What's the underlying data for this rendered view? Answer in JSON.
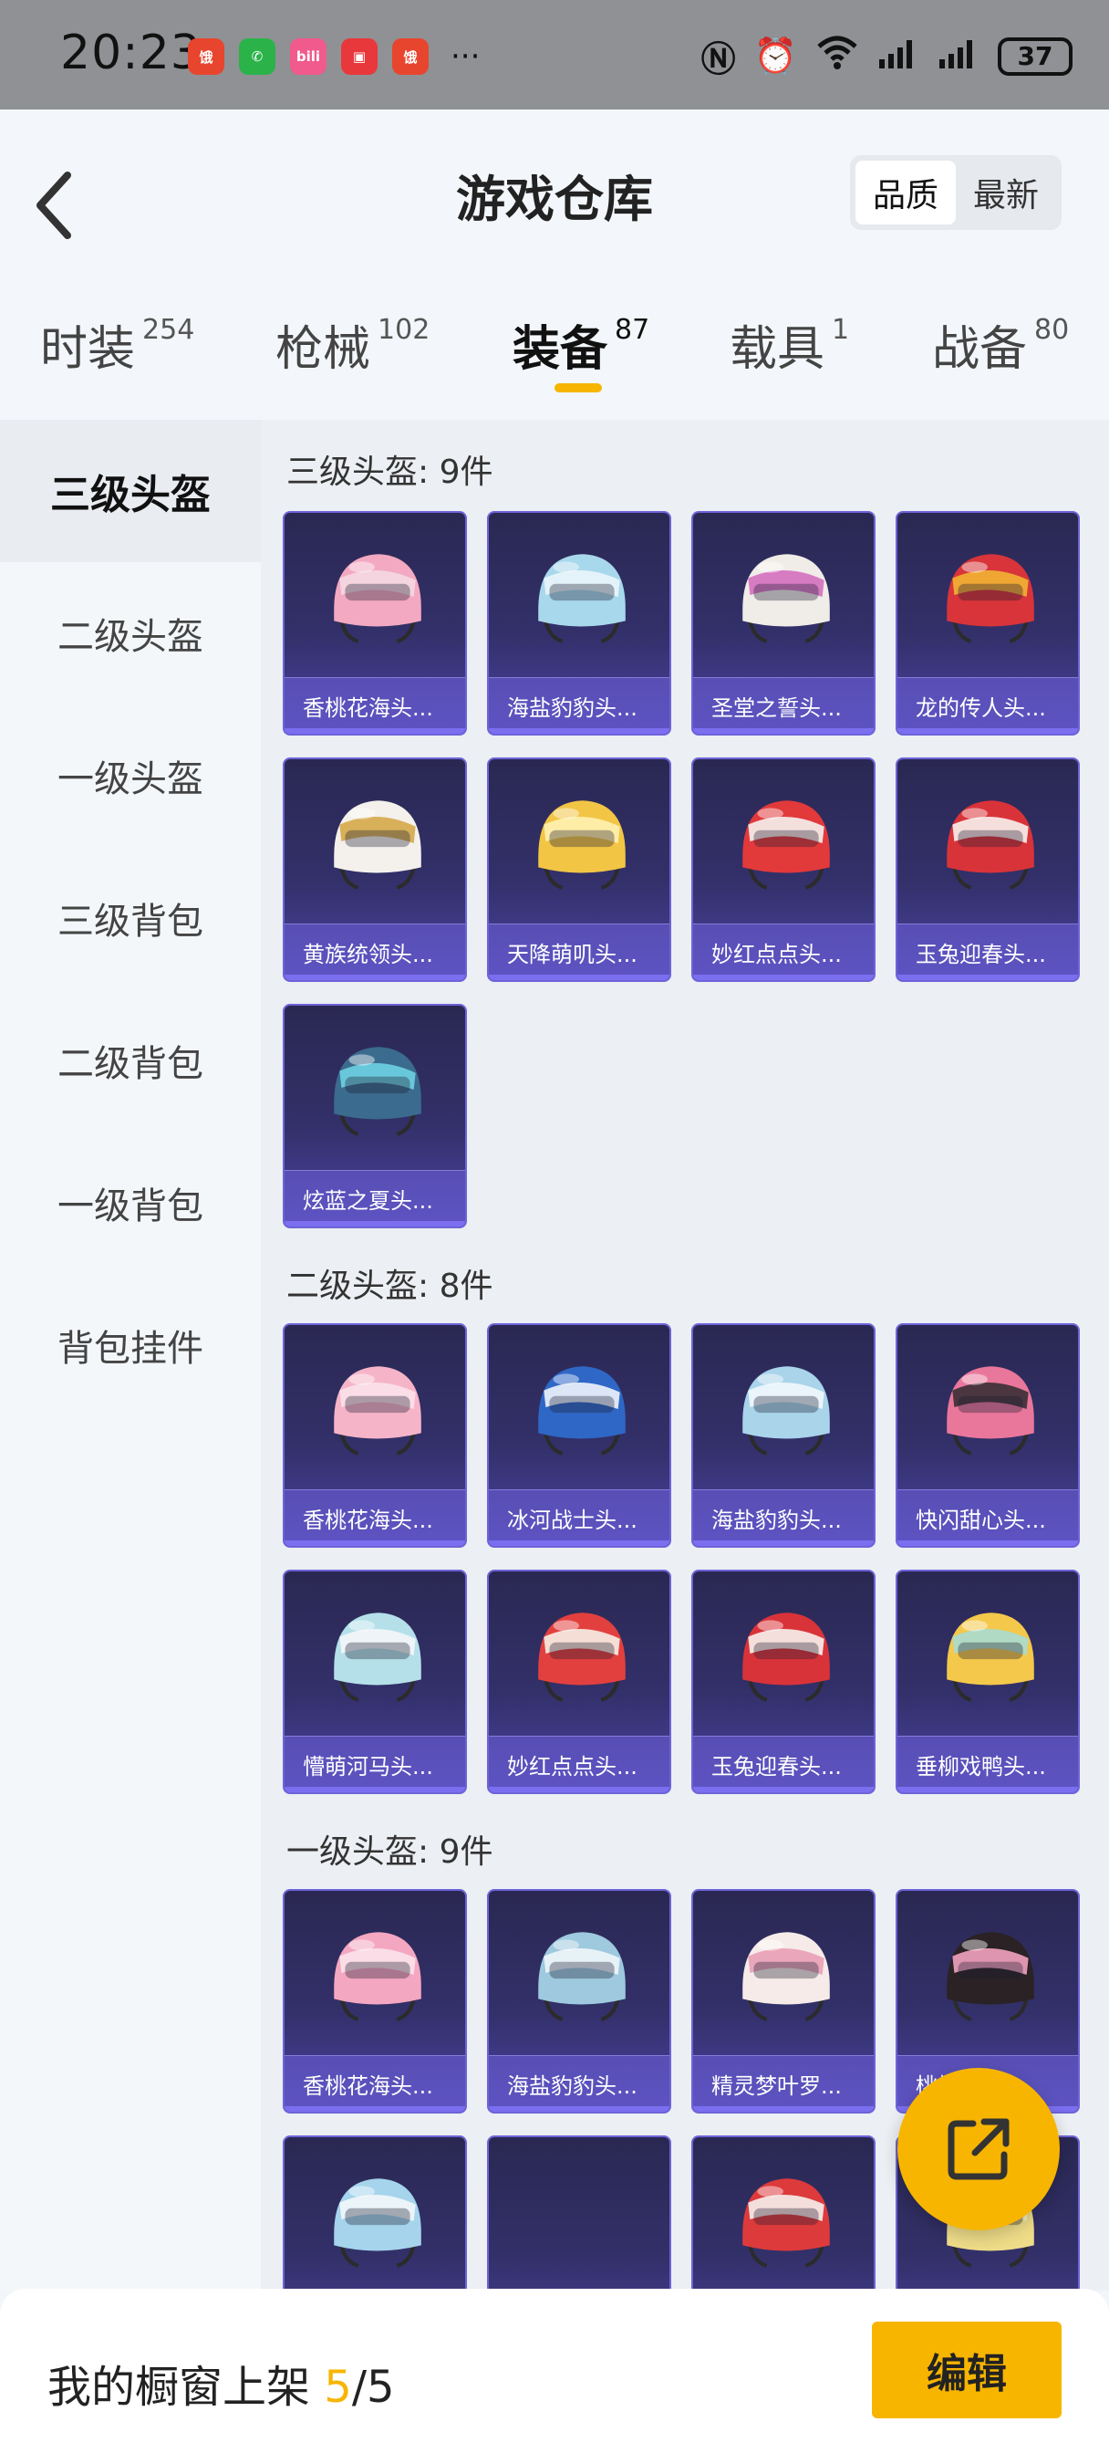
{
  "status_bar": {
    "time": "20:23",
    "apps": [
      {
        "name": "food-app-icon",
        "color": "#e8452e",
        "glyph": "饿"
      },
      {
        "name": "wechat-icon",
        "color": "#2bb34a",
        "glyph": "✆"
      },
      {
        "name": "bilibili-icon",
        "color": "#f05a8c",
        "glyph": "bili"
      },
      {
        "name": "red-app-icon",
        "color": "#e8383b",
        "glyph": "▣"
      },
      {
        "name": "food-app-icon-2",
        "color": "#e8452e",
        "glyph": "饿"
      }
    ],
    "more": "···",
    "battery": "37"
  },
  "header": {
    "title": "游戏仓库",
    "sort": [
      {
        "label": "品质",
        "active": true
      },
      {
        "label": "最新",
        "active": false
      }
    ]
  },
  "tabs": [
    {
      "label": "时装",
      "count": "254",
      "active": false
    },
    {
      "label": "枪械",
      "count": "102",
      "active": false
    },
    {
      "label": "装备",
      "count": "87",
      "active": true
    },
    {
      "label": "载具",
      "count": "1",
      "active": false
    },
    {
      "label": "战备",
      "count": "80",
      "active": false
    }
  ],
  "sidebar": {
    "items": [
      "三级头盔",
      "二级头盔",
      "一级头盔",
      "三级背包",
      "二级背包",
      "一级背包",
      "背包挂件"
    ],
    "active_index": 0
  },
  "sections": [
    {
      "title": "三级头盔: 9件",
      "items": [
        {
          "name": "香桃花海头...",
          "color": "#f3a9c1",
          "accent": "#f4d8e2"
        },
        {
          "name": "海盐豹豹头...",
          "color": "#a8d8ec",
          "accent": "#eaf6fb"
        },
        {
          "name": "圣堂之誓头...",
          "color": "#f0ece8",
          "accent": "#d46fbf"
        },
        {
          "name": "龙的传人头...",
          "color": "#d8343a",
          "accent": "#f2b233"
        },
        {
          "name": "黄族统领头...",
          "color": "#f4f1ec",
          "accent": "#d6a84a"
        },
        {
          "name": "天降萌叽头...",
          "color": "#f2c545",
          "accent": "#fff1b0"
        },
        {
          "name": "妙红点点头...",
          "color": "#e2393b",
          "accent": "#f5f3f0"
        },
        {
          "name": "玉兔迎春头...",
          "color": "#d9333a",
          "accent": "#f7f2ee"
        },
        {
          "name": "炫蓝之夏头...",
          "color": "#3b6b8e",
          "accent": "#6fd1e3"
        }
      ]
    },
    {
      "title": "二级头盔: 8件",
      "items": [
        {
          "name": "香桃花海头...",
          "color": "#f6b4c8",
          "accent": "#fbe1ea"
        },
        {
          "name": "冰河战士头...",
          "color": "#2f67c6",
          "accent": "#f0f4fb"
        },
        {
          "name": "海盐豹豹头...",
          "color": "#a9d4ea",
          "accent": "#f0f8fc"
        },
        {
          "name": "快闪甜心头...",
          "color": "#e9779b",
          "accent": "#3a2f35"
        },
        {
          "name": "懵萌河马头...",
          "color": "#b5e0ea",
          "accent": "#f4f6f8"
        },
        {
          "name": "妙红点点头...",
          "color": "#e2403e",
          "accent": "#f7efe6"
        },
        {
          "name": "玉兔迎春头...",
          "color": "#d9333a",
          "accent": "#f7f2ee"
        },
        {
          "name": "垂柳戏鸭头...",
          "color": "#f4c84a",
          "accent": "#a8dcd2"
        }
      ]
    },
    {
      "title": "一级头盔: 9件",
      "items": [
        {
          "name": "香桃花海头...",
          "color": "#f4a7c0",
          "accent": "#fbe3ea"
        },
        {
          "name": "海盐豹豹头...",
          "color": "#9ec9df",
          "accent": "#eef6fa"
        },
        {
          "name": "精灵梦叶罗...",
          "color": "#f6ebe9",
          "accent": "#e9a0b6"
        },
        {
          "name": "桃桃心头...",
          "color": "#2a2224",
          "accent": "#f2a2c0"
        },
        {
          "name": "",
          "color": "#a5d4ec",
          "accent": "#f3f7fa"
        },
        {
          "name": "",
          "color": "#3a3a66",
          "accent": "#3a3a66"
        },
        {
          "name": "",
          "color": "#dd3a3c",
          "accent": "#f6f1ec"
        },
        {
          "name": "",
          "color": "#eedc88",
          "accent": "#f7f1c7"
        }
      ]
    }
  ],
  "fab": {
    "icon": "share-external-icon"
  },
  "bottom_bar": {
    "label": "我的橱窗上架",
    "current": "5",
    "separator": "/",
    "total": "5",
    "edit_label": "编辑"
  },
  "colors": {
    "accent": "#f7b500",
    "card_border": "#6d63d8",
    "card_bg": "#2a2852"
  }
}
